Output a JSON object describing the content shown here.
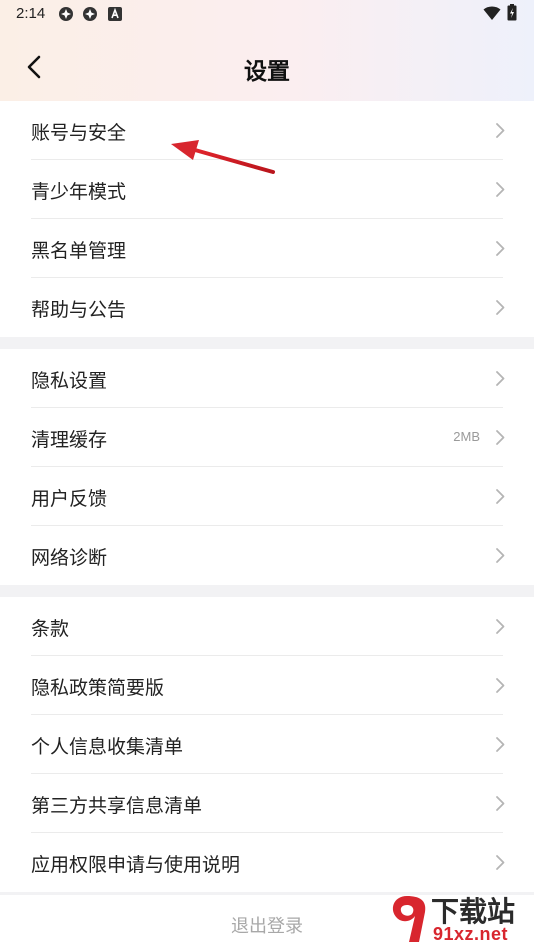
{
  "status_bar": {
    "time": "2:14",
    "icons_left": [
      "app-icon",
      "app-icon",
      "notification-a-icon"
    ],
    "icons_right": [
      "wifi-icon",
      "battery-icon"
    ]
  },
  "header": {
    "title": "设置",
    "back_icon": "chevron-left-icon"
  },
  "groups": [
    {
      "items": [
        {
          "label": "账号与安全"
        },
        {
          "label": "青少年模式"
        },
        {
          "label": "黑名单管理"
        },
        {
          "label": "帮助与公告"
        }
      ]
    },
    {
      "items": [
        {
          "label": "隐私设置"
        },
        {
          "label": "清理缓存",
          "value": "2MB"
        },
        {
          "label": "用户反馈"
        },
        {
          "label": "网络诊断"
        }
      ]
    },
    {
      "items": [
        {
          "label": "条款"
        },
        {
          "label": "隐私政策简要版"
        },
        {
          "label": "个人信息收集清单"
        },
        {
          "label": "第三方共享信息清单"
        },
        {
          "label": "应用权限申请与使用说明"
        }
      ]
    }
  ],
  "logout_label": "退出登录",
  "annotation": {
    "arrow_color": "#d8262e"
  },
  "watermark": {
    "brand": "下载站",
    "site": "91xz.net"
  },
  "colors": {
    "accent_red": "#d8262e",
    "chevron": "#b5b5b5"
  }
}
